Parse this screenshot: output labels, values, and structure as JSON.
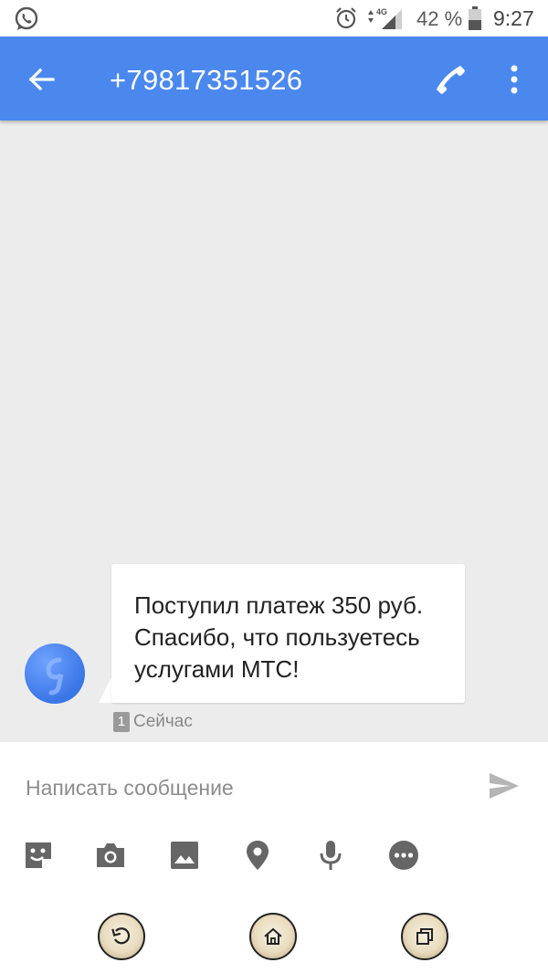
{
  "status_bar": {
    "battery_percent": "42 %",
    "time": "9:27",
    "network": "4G"
  },
  "app_bar": {
    "title": "+79817351526"
  },
  "message": {
    "text": "Поступил платеж 350 руб. Спасибо, что пользуетесь услугами МТС!",
    "sim": "1",
    "timestamp": "Сейчас"
  },
  "compose": {
    "placeholder": "Написать сообщение",
    "value": ""
  },
  "colors": {
    "app_bar": "#4a88ee",
    "background": "#ececec",
    "avatar": "#3a76e6"
  }
}
